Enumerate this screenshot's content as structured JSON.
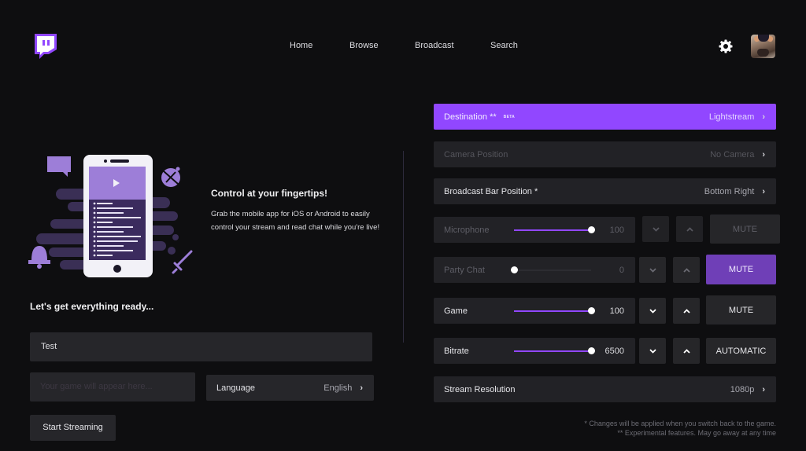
{
  "header": {
    "logo": "twitch-glitch-logo",
    "nav": [
      {
        "label": "Home"
      },
      {
        "label": "Browse"
      },
      {
        "label": "Broadcast"
      },
      {
        "label": "Search"
      }
    ],
    "settings_icon": "gear-icon",
    "avatar": "user-avatar"
  },
  "promo": {
    "title": "Control at your fingertips!",
    "body": "Grab the mobile app for iOS or Android to easily control your stream and read chat while you're live!"
  },
  "setup": {
    "heading": "Let's get everything ready...",
    "stream_title_value": "Test",
    "game_placeholder": "Your game will appear here...",
    "language": {
      "label": "Language",
      "value": "English"
    },
    "start_button": "Start Streaming"
  },
  "settings": {
    "destination": {
      "label": "Destination **",
      "badge": "BETA",
      "value": "Lightstream",
      "enabled": true
    },
    "camera_position": {
      "label": "Camera Position",
      "value": "No Camera",
      "enabled": false
    },
    "broadcast_bar_position": {
      "label": "Broadcast Bar Position *",
      "value": "Bottom Right"
    },
    "microphone": {
      "label": "Microphone",
      "value": "100",
      "level_percent": 100,
      "mute_label": "MUTE",
      "muted": false,
      "enabled": false
    },
    "party_chat": {
      "label": "Party Chat",
      "value": "0",
      "level_percent": 0,
      "mute_label": "MUTE",
      "muted": true,
      "enabled": false
    },
    "game": {
      "label": "Game",
      "value": "100",
      "level_percent": 100,
      "mute_label": "MUTE",
      "muted": false,
      "enabled": true
    },
    "bitrate": {
      "label": "Bitrate",
      "value": "6500",
      "level_percent": 100,
      "mode_label": "AUTOMATIC",
      "enabled": true
    },
    "stream_resolution": {
      "label": "Stream Resolution",
      "value": "1080p"
    }
  },
  "notes": {
    "line1": "* Changes will be applied when you switch back to the game.",
    "line2": "** Experimental features. May go away at any time"
  },
  "colors": {
    "brand": "#9147ff",
    "muted_active": "#6f3fb7",
    "background": "#0e0e10",
    "surface": "#222226"
  }
}
